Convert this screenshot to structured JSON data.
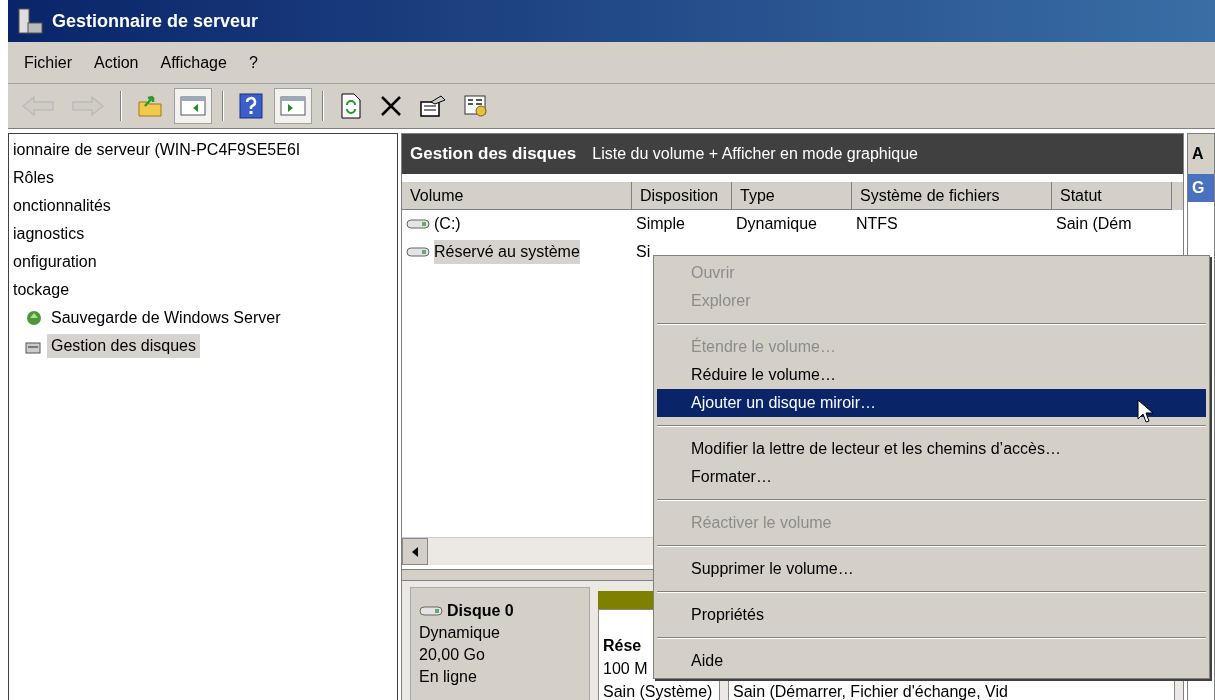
{
  "window": {
    "title": "Gestionnaire de serveur"
  },
  "menu_bar": [
    "Fichier",
    "Action",
    "Affichage",
    "?"
  ],
  "toolbar": [
    {
      "kind": "back",
      "disabled": true,
      "pressed": false
    },
    {
      "kind": "forward",
      "disabled": true,
      "pressed": false
    },
    {
      "kind": "separator"
    },
    {
      "kind": "folder-up",
      "disabled": false,
      "pressed": false
    },
    {
      "kind": "tree-pane",
      "disabled": false,
      "pressed": true
    },
    {
      "kind": "separator"
    },
    {
      "kind": "help",
      "disabled": false,
      "pressed": false
    },
    {
      "kind": "action-pane",
      "disabled": false,
      "pressed": true
    },
    {
      "kind": "separator"
    },
    {
      "kind": "refresh",
      "disabled": false,
      "pressed": false
    },
    {
      "kind": "delete",
      "disabled": false,
      "pressed": false
    },
    {
      "kind": "properties",
      "disabled": false,
      "pressed": false
    },
    {
      "kind": "settings",
      "disabled": false,
      "pressed": false
    }
  ],
  "tree": {
    "label": "ionnaire de serveur (WIN-PC4F9SE5E6I",
    "selected": false,
    "children": [
      {
        "label": "Rôles",
        "selected": false
      },
      {
        "label": "onctionnalités",
        "selected": false
      },
      {
        "label": "iagnostics",
        "selected": false
      },
      {
        "label": "onfiguration",
        "selected": false
      },
      {
        "label": "tockage",
        "selected": false,
        "children": [
          {
            "label": "Sauvegarde de Windows Server",
            "selected": false
          },
          {
            "label": "Gestion des disques",
            "selected": true
          }
        ]
      }
    ]
  },
  "panel_header": {
    "title": "Gestion des disques",
    "subtitle": "Liste du volume + Afficher en mode graphique"
  },
  "table": {
    "columns": [
      "Volume",
      "Disposition",
      "Type",
      "Système de fichiers",
      "Statut"
    ],
    "rows": [
      {
        "selected": false,
        "cells": [
          "(C:)",
          "Simple",
          "Dynamique",
          "NTFS",
          "Sain (Dém"
        ]
      },
      {
        "selected": true,
        "cells": [
          "Réservé au système",
          "Si",
          "",
          "",
          ""
        ]
      }
    ]
  },
  "disk": {
    "name": "Disque 0",
    "lines": [
      "Dynamique",
      "20,00 Go",
      "En ligne"
    ],
    "partitions": [
      {
        "title": "Rése",
        "lines": [
          "100 M",
          "Sain (Système)"
        ]
      },
      {
        "lines": [
          "Sain (Démarrer, Fichier d'échange, Vid"
        ]
      }
    ]
  },
  "action_pane": {
    "header": "A",
    "bar": "G"
  },
  "context_menu": [
    {
      "kind": "item",
      "label": "Ouvrir",
      "disabled": true,
      "selected": false
    },
    {
      "kind": "item",
      "label": "Explorer",
      "disabled": true,
      "selected": false
    },
    {
      "kind": "separator"
    },
    {
      "kind": "item",
      "label": "Étendre le volume…",
      "disabled": true,
      "selected": false
    },
    {
      "kind": "item",
      "label": "Réduire le volume…",
      "disabled": false,
      "selected": false
    },
    {
      "kind": "item",
      "label": "Ajouter un disque miroir…",
      "disabled": false,
      "selected": true
    },
    {
      "kind": "separator"
    },
    {
      "kind": "item",
      "label": "Modifier la lettre de lecteur et les chemins d’accès…",
      "disabled": false,
      "selected": false
    },
    {
      "kind": "item",
      "label": "Formater…",
      "disabled": false,
      "selected": false
    },
    {
      "kind": "separator"
    },
    {
      "kind": "item",
      "label": "Réactiver le volume",
      "disabled": true,
      "selected": false
    },
    {
      "kind": "separator"
    },
    {
      "kind": "item",
      "label": "Supprimer le volume…",
      "disabled": false,
      "selected": false
    },
    {
      "kind": "separator"
    },
    {
      "kind": "item",
      "label": "Propriétés",
      "disabled": false,
      "selected": false
    },
    {
      "kind": "separator"
    },
    {
      "kind": "item",
      "label": "Aide",
      "disabled": false,
      "selected": false
    }
  ]
}
